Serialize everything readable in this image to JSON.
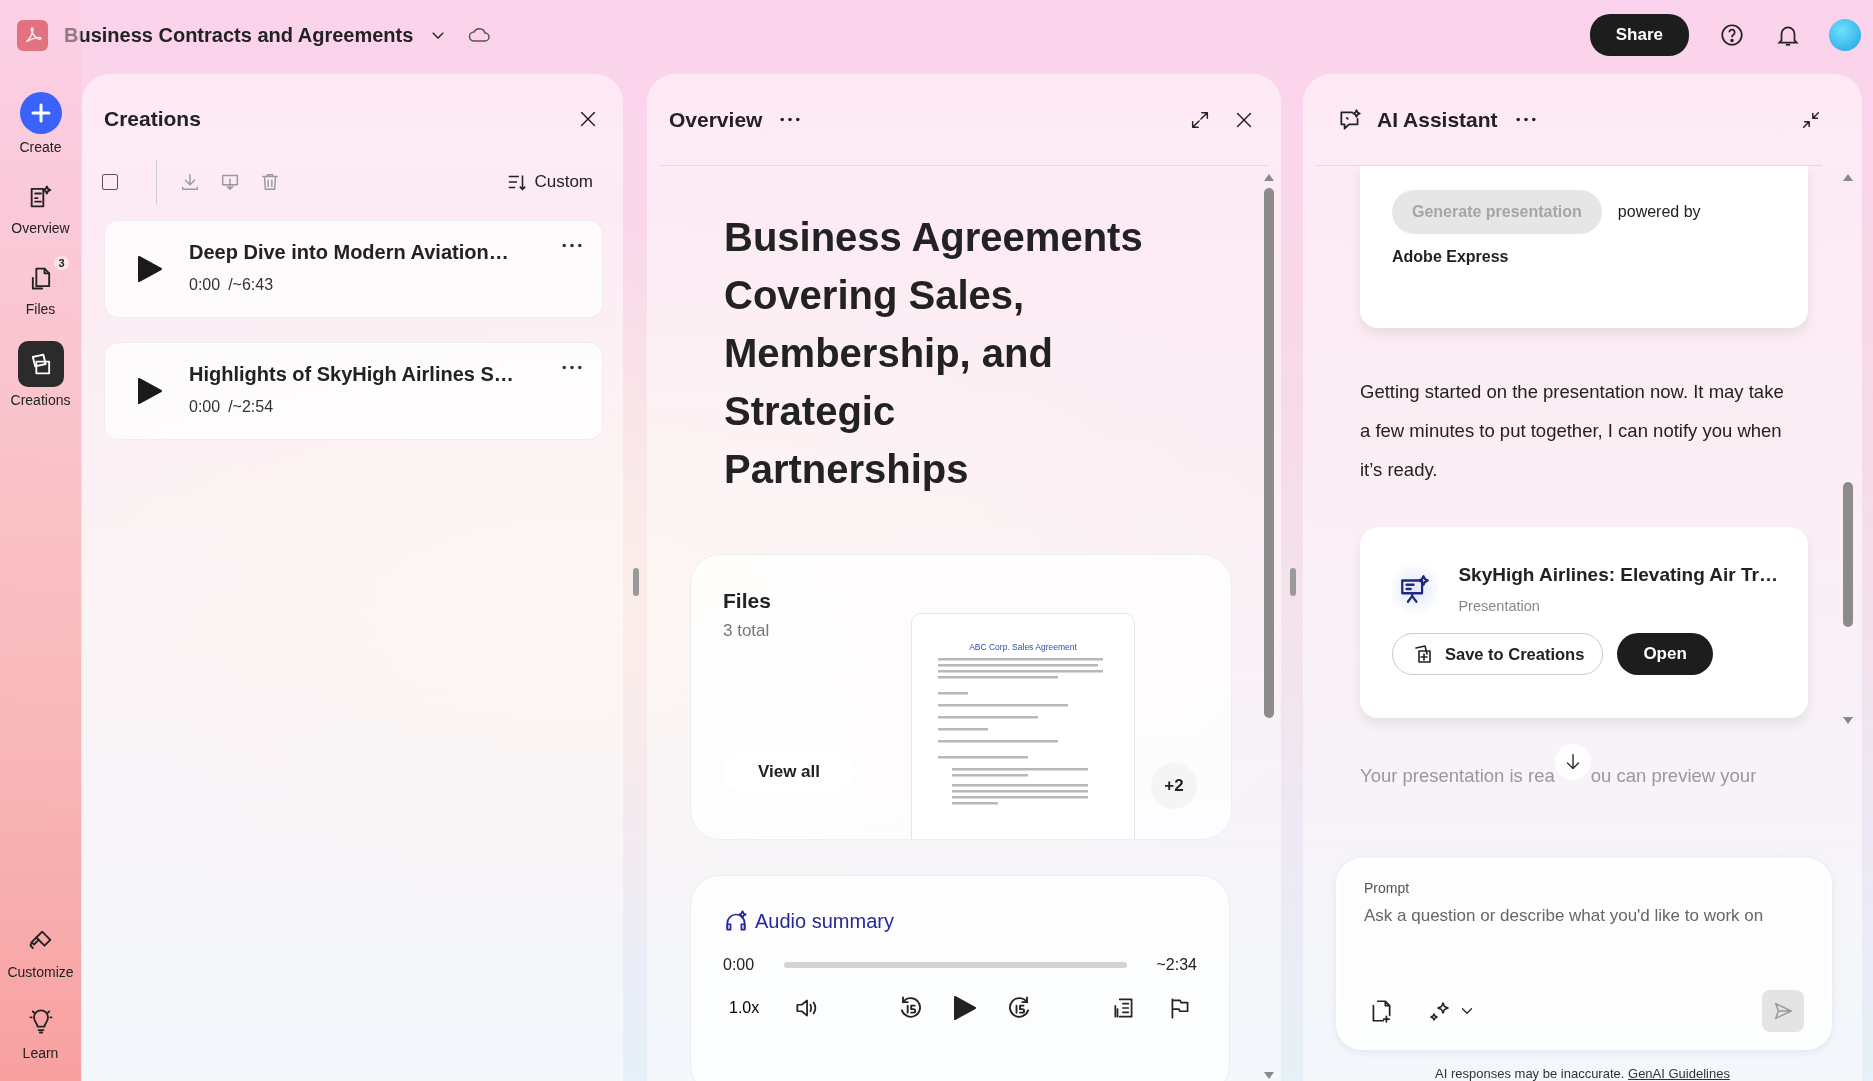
{
  "topbar": {
    "title": "Business Contracts and Agreements",
    "share": "Share"
  },
  "rail": {
    "items": [
      {
        "kind": "create",
        "label": "Create",
        "selected": false
      },
      {
        "kind": "overview",
        "label": "Overview",
        "selected": false
      },
      {
        "kind": "files",
        "label": "Files",
        "badge": "3",
        "selected": false
      },
      {
        "kind": "creations",
        "label": "Creations",
        "selected": true
      }
    ],
    "bottom": [
      {
        "kind": "customize",
        "label": "Customize",
        "selected": false
      },
      {
        "kind": "learn",
        "label": "Learn",
        "selected": false
      }
    ]
  },
  "creations": {
    "title": "Creations",
    "select_all": {
      "checked": false
    },
    "sort": "Custom",
    "items": [
      {
        "title": "Deep Dive into Modern Aviation…",
        "time": "0:00",
        "duration": "/~6:43"
      },
      {
        "title": "Highlights of SkyHigh Airlines S…",
        "time": "0:00",
        "duration": "/~2:54"
      }
    ]
  },
  "overview": {
    "title": "Overview",
    "heading": "Business Agreements Covering Sales, Membership, and Strategic Partnerships",
    "files": {
      "title": "Files",
      "count": "3 total",
      "button": "View all",
      "document_title": "ABC Corp. Sales Agreement",
      "more": "+2"
    },
    "audio": {
      "title": "Audio summary",
      "current": "0:00",
      "total": "~2:34",
      "level": 0,
      "speed": "1.0x"
    }
  },
  "assistant": {
    "title": "AI Assistant",
    "generate": {
      "label": "Generate presentation",
      "disabled": true
    },
    "powered_by": "powered by",
    "provider": "Adobe Express",
    "message": "Getting started on the presentation now. It may take a few minutes to put together, I can notify you when it’s ready.",
    "result": {
      "title": "SkyHigh Airlines: Elevating Air Tr…",
      "type": "Presentation",
      "save": "Save to Creations",
      "open": "Open"
    },
    "faded_before": "Your presentation is rea",
    "faded_after": "ou can preview your",
    "prompt": {
      "label": "Prompt",
      "placeholder": "Ask a question or describe what you'd like to work on"
    },
    "footer": "AI responses may be inaccurate.",
    "footer_link": "GenAI Guidelines"
  }
}
